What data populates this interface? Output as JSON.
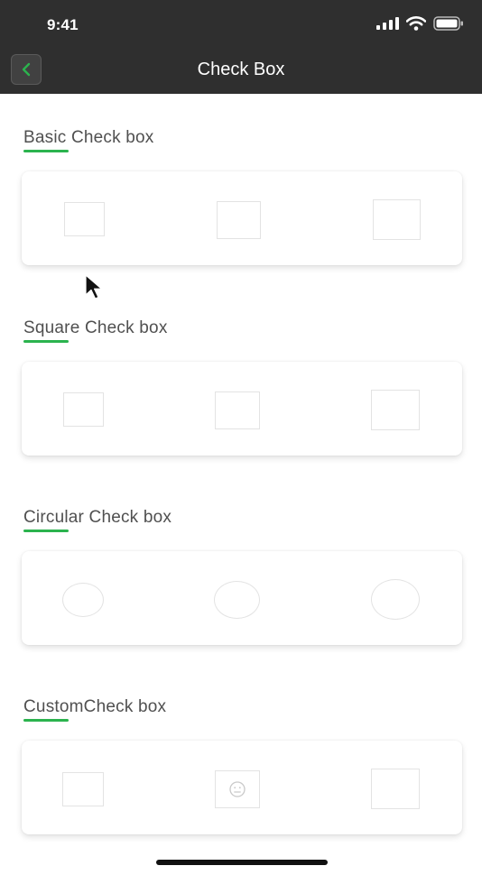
{
  "status_bar": {
    "time": "9:41"
  },
  "nav": {
    "title": "Check Box",
    "back_icon": "chevron-left-icon"
  },
  "colors": {
    "nav_background": "#2f2f2f",
    "accent": "#2bb34e",
    "checkbox_border": "#e3e3e3"
  },
  "sections": [
    {
      "title": "Basic Check box",
      "shape": "square",
      "checked": [
        false,
        false,
        false
      ]
    },
    {
      "title": "Square Check box",
      "shape": "square",
      "checked": [
        false,
        false,
        false
      ]
    },
    {
      "title": "Circular Check box",
      "shape": "circle",
      "checked": [
        false,
        false,
        false
      ]
    },
    {
      "title": "CustomCheck box",
      "shape": "custom",
      "middle_icon": "neutral-face-icon",
      "checked": [
        false,
        false,
        false
      ]
    }
  ]
}
